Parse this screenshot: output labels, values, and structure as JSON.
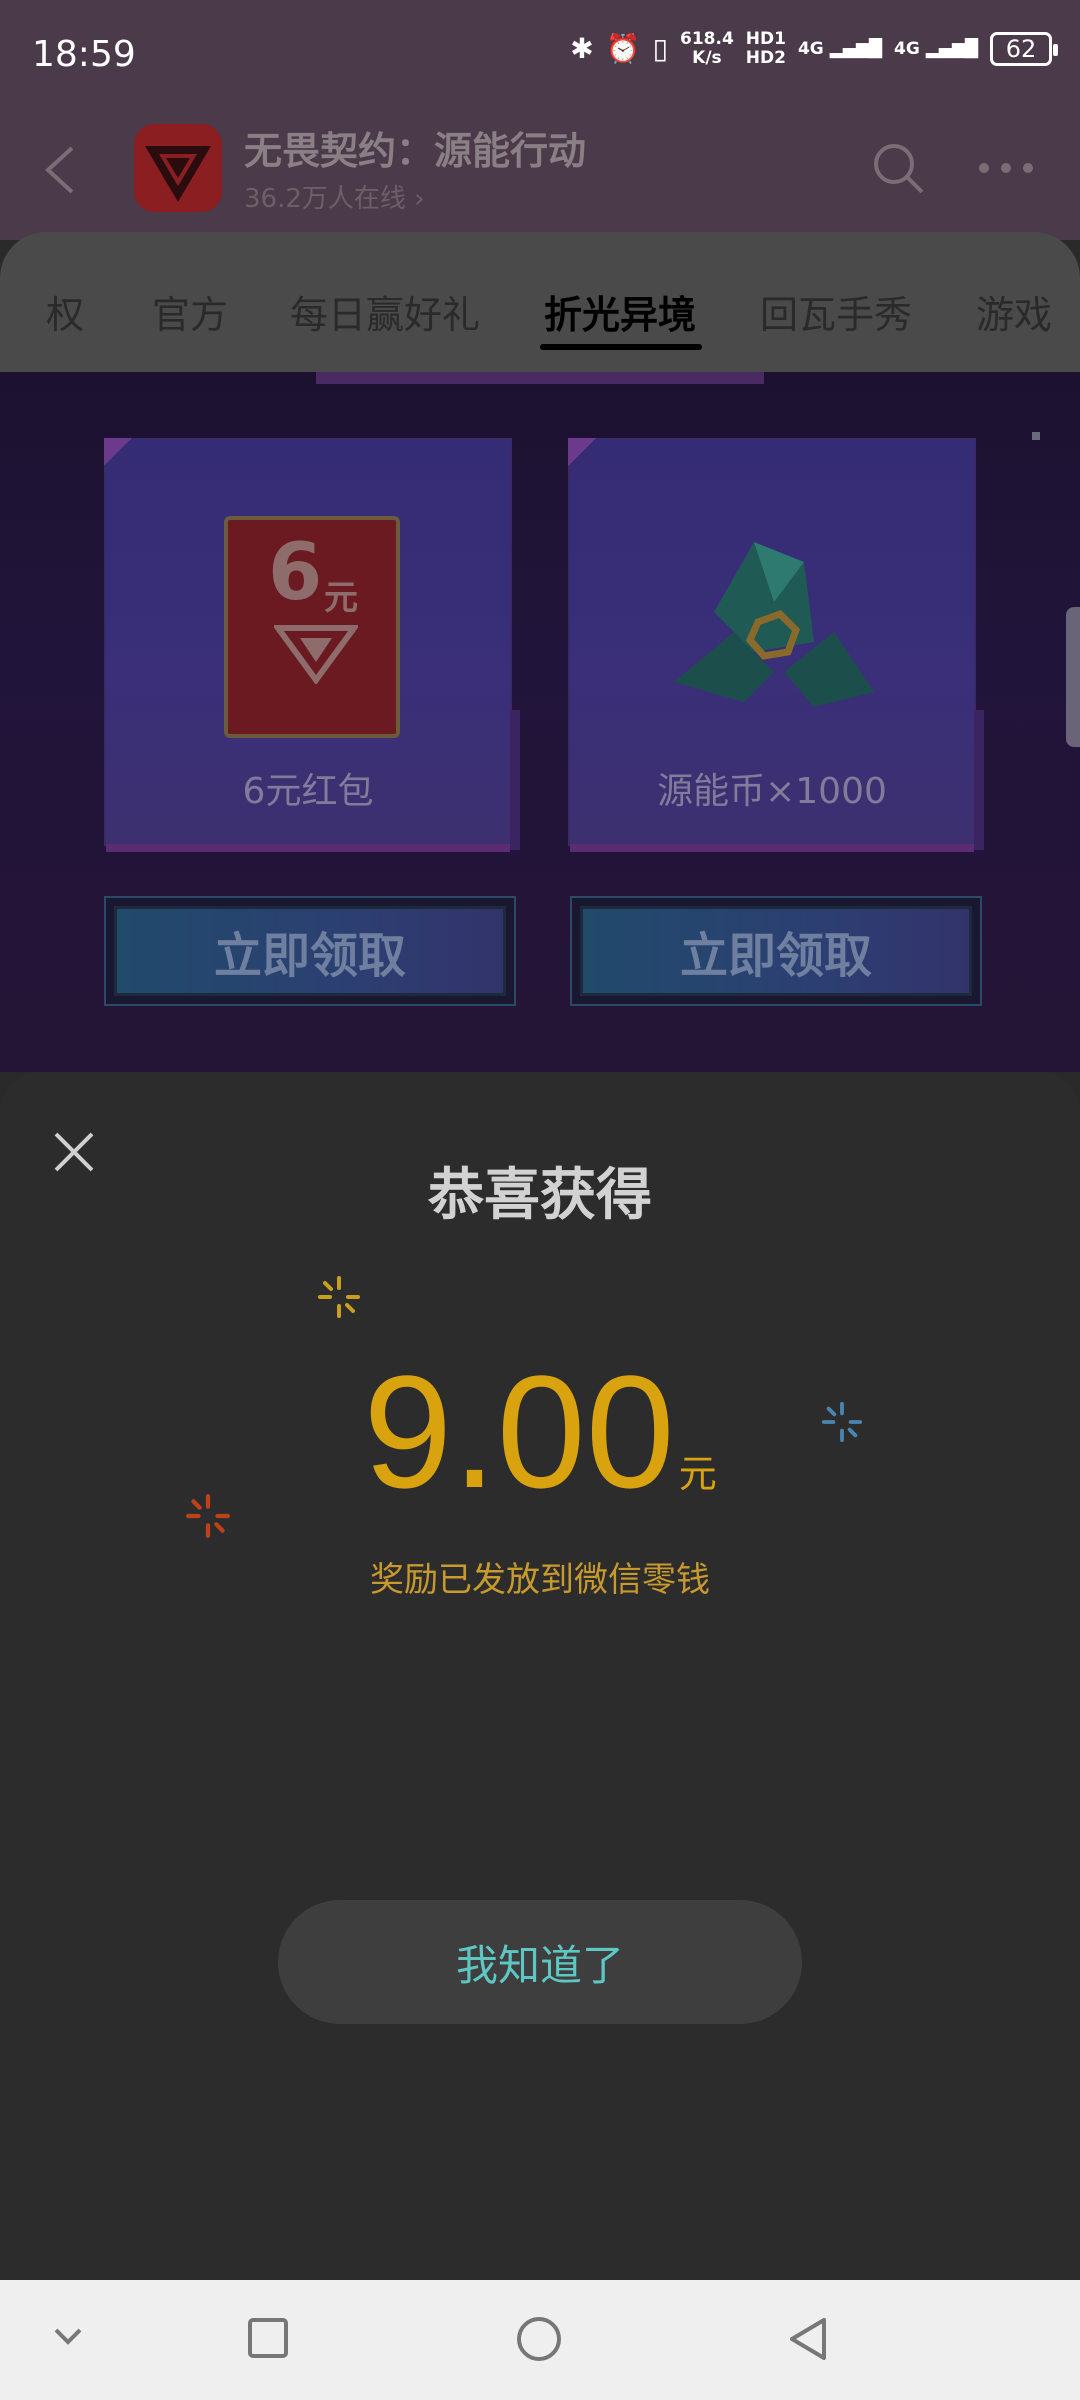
{
  "status_bar": {
    "time": "18:59",
    "net_speed_value": "618.4",
    "net_speed_unit": "K/s",
    "hd1": "HD1",
    "hd2": "HD2",
    "net1": "4G",
    "net2": "4G",
    "battery": "62"
  },
  "header": {
    "title": "无畏契约：源能行动",
    "online": "36.2万人在线 ›"
  },
  "tabs": [
    {
      "label": "权"
    },
    {
      "label": "官方"
    },
    {
      "label": "每日赢好礼"
    },
    {
      "label": "折光异境",
      "active": true
    },
    {
      "label": "回瓦手秀"
    },
    {
      "label": "游戏"
    }
  ],
  "cards": [
    {
      "label": "6元红包",
      "badge_number": "6",
      "badge_unit": "元",
      "button": "立即领取"
    },
    {
      "label": "源能币×1000",
      "button": "立即领取"
    }
  ],
  "modal": {
    "title": "恭喜获得",
    "amount": "9.00",
    "unit": "元",
    "note": "奖励已发放到微信零钱",
    "confirm": "我知道了"
  },
  "colors": {
    "gold": "#d8a30e",
    "teal": "#5fc7c3",
    "sheet_bg": "#2c2c2c"
  }
}
